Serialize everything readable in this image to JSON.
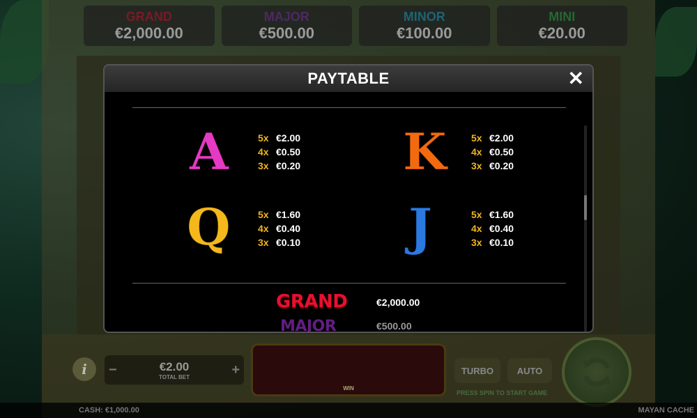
{
  "jackpots": [
    {
      "label": "GRAND",
      "value": "€2,000.00",
      "color": "#c8102e"
    },
    {
      "label": "MAJOR",
      "value": "€500.00",
      "color": "#7a2aa8"
    },
    {
      "label": "MINOR",
      "value": "€100.00",
      "color": "#1aa0c8"
    },
    {
      "label": "MINI",
      "value": "€20.00",
      "color": "#2aa84a"
    }
  ],
  "paytable": {
    "title": "PAYTABLE",
    "close_label": "✕",
    "symbols": [
      {
        "letter": "A",
        "color": "#e63ac4",
        "pays": [
          {
            "m": "5x",
            "v": "€2.00"
          },
          {
            "m": "4x",
            "v": "€0.50"
          },
          {
            "m": "3x",
            "v": "€0.20"
          }
        ]
      },
      {
        "letter": "K",
        "color": "#f26a10",
        "pays": [
          {
            "m": "5x",
            "v": "€2.00"
          },
          {
            "m": "4x",
            "v": "€0.50"
          },
          {
            "m": "3x",
            "v": "€0.20"
          }
        ]
      },
      {
        "letter": "Q",
        "color": "#f5b81c",
        "pays": [
          {
            "m": "5x",
            "v": "€1.60"
          },
          {
            "m": "4x",
            "v": "€0.40"
          },
          {
            "m": "3x",
            "v": "€0.10"
          }
        ]
      },
      {
        "letter": "J",
        "color": "#2a7ae0",
        "pays": [
          {
            "m": "5x",
            "v": "€1.60"
          },
          {
            "m": "4x",
            "v": "€0.40"
          },
          {
            "m": "3x",
            "v": "€0.10"
          }
        ]
      }
    ],
    "jackpots": [
      {
        "label": "GRAND",
        "value": "€2,000.00",
        "color": "#e8102e"
      },
      {
        "label": "MAJOR",
        "value": "€500.00",
        "color": "#8a2ab8"
      }
    ]
  },
  "controls": {
    "info_label": "i",
    "bet_value": "€2.00",
    "bet_label": "TOTAL BET",
    "minus": "−",
    "plus": "+",
    "win_label": "WIN",
    "turbo_label": "TURBO",
    "auto_label": "AUTO",
    "press_spin": "PRESS SPIN TO START GAME"
  },
  "footer": {
    "cash": "CASH: €1,000.00",
    "game_name": "MAYAN CACHE"
  }
}
